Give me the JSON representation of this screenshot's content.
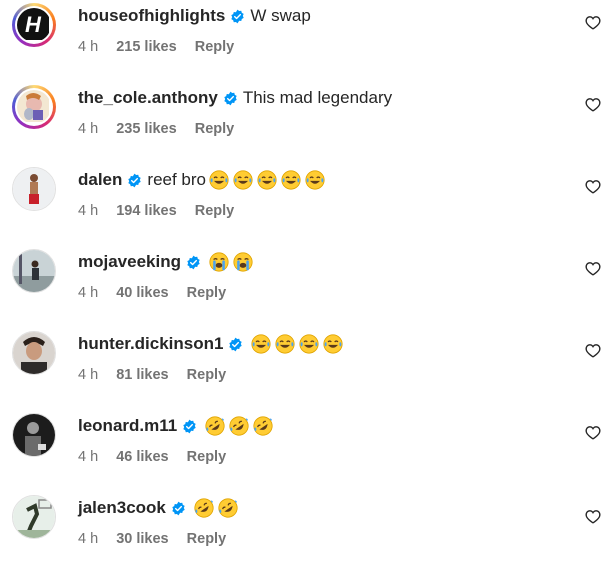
{
  "comments": [
    {
      "username": "houseofhighlights",
      "text": "W swap",
      "emojis": [],
      "emoji_type": "",
      "time": "4 h",
      "likes": "215 likes",
      "reply": "Reply",
      "avatar": "hoh-logo",
      "story_ring": true
    },
    {
      "username": "the_cole.anthony",
      "text": "This mad legendary",
      "emojis": [],
      "emoji_type": "",
      "time": "4 h",
      "likes": "235 likes",
      "reply": "Reply",
      "avatar": "cartoon-avatar",
      "story_ring": true
    },
    {
      "username": "dalen",
      "text": "reef bro",
      "emojis": [
        "joy",
        "joy",
        "joy",
        "joy",
        "joy"
      ],
      "emoji_type": "face-with-tears-of-joy",
      "time": "4 h",
      "likes": "194 likes",
      "reply": "Reply",
      "avatar": "player-photo",
      "story_ring": false
    },
    {
      "username": "mojaveeking",
      "text": "",
      "emojis": [
        "cry",
        "cry"
      ],
      "emoji_type": "loudly-crying-face",
      "time": "4 h",
      "likes": "40 likes",
      "reply": "Reply",
      "avatar": "court-photo",
      "story_ring": false
    },
    {
      "username": "hunter.dickinson1",
      "text": "",
      "emojis": [
        "joy",
        "joy",
        "joy",
        "joy"
      ],
      "emoji_type": "face-with-tears-of-joy",
      "time": "4 h",
      "likes": "81 likes",
      "reply": "Reply",
      "avatar": "portrait-photo",
      "story_ring": false
    },
    {
      "username": "leonard.m11",
      "text": "",
      "emojis": [
        "rofl",
        "rofl",
        "rofl"
      ],
      "emoji_type": "rolling-on-the-floor-laughing",
      "time": "4 h",
      "likes": "46 likes",
      "reply": "Reply",
      "avatar": "bw-photo",
      "story_ring": false
    },
    {
      "username": "jalen3cook",
      "text": "",
      "emojis": [
        "rofl",
        "rofl"
      ],
      "emoji_type": "rolling-on-the-floor-laughing",
      "time": "4 h",
      "likes": "30 likes",
      "reply": "Reply",
      "avatar": "dunk-photo",
      "story_ring": false
    }
  ],
  "colors": {
    "verified": "#0095f6",
    "muted": "#737373",
    "text": "#262626"
  }
}
